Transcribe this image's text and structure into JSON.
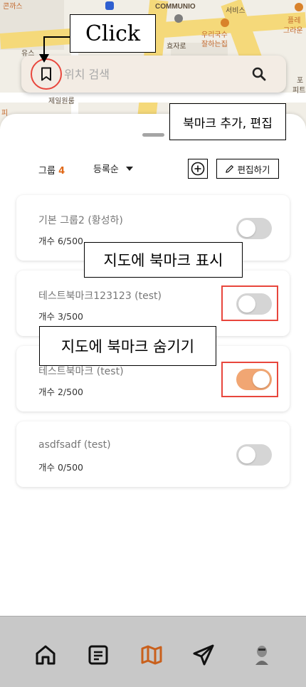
{
  "map": {
    "labels": {
      "top_left": "콘까스",
      "communio": "COMMUNIO",
      "services": "서비스",
      "upper_right": "플레",
      "upper_right2": "그라운",
      "woori_1": "우리국수",
      "woori_2": "잘하는집",
      "hero": "효자로",
      "mid_left": "유스",
      "jeil": "제일원룸",
      "far_right1": "포",
      "far_right2": "피트",
      "left_edge": "피"
    }
  },
  "search": {
    "placeholder": "위치 검색"
  },
  "annotations": {
    "click": "Click",
    "bookmark_add_edit": "북마크 추가, 편집",
    "show_on_map": "지도에 북마크 표시",
    "hide_on_map": "지도에 북마크 숨기기"
  },
  "list": {
    "group_label": "그룹",
    "group_count": "4",
    "sort_label": "등록순",
    "edit_label": "편집하기"
  },
  "groups": [
    {
      "title": "기본 그룹2 (황성하)",
      "count": "개수 6/500",
      "enabled": false
    },
    {
      "title": "테스트북마크123123 (test)",
      "count": "개수 3/500",
      "enabled": false
    },
    {
      "title": "테스트북마크 (test)",
      "count": "개수 2/500",
      "enabled": true
    },
    {
      "title": "asdfsadf (test)",
      "count": "개수 0/500",
      "enabled": false
    }
  ],
  "colors": {
    "accent": "#e06a1a",
    "toggle_on": "#f1a673",
    "highlight": "#e8463c"
  },
  "nav": {
    "items": [
      "home-icon",
      "board-icon",
      "map-icon",
      "send-icon",
      "profile-avatar"
    ],
    "active": "map-icon"
  }
}
